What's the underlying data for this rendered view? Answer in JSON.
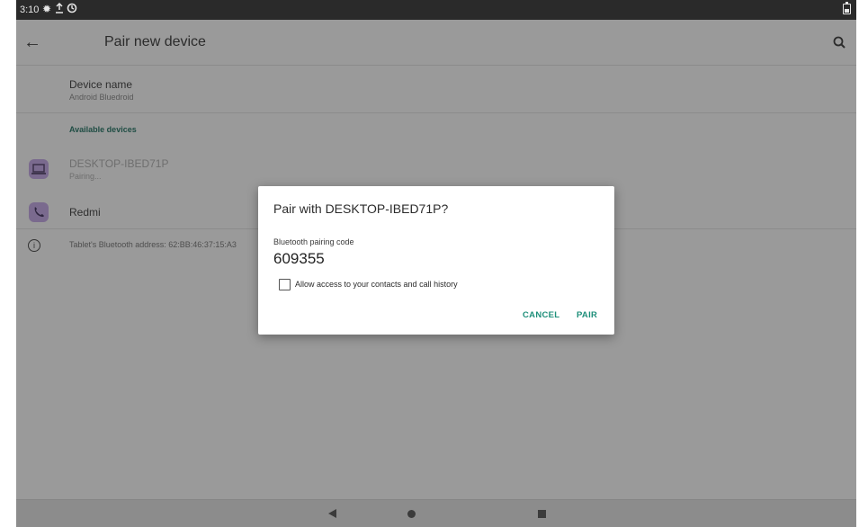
{
  "status_bar": {
    "time": "3:10",
    "icons": [
      "gear-icon",
      "upload-icon",
      "sync-icon",
      "battery-icon"
    ]
  },
  "app_bar": {
    "title": "Pair new device",
    "back_icon": "arrow-back-icon",
    "search_icon": "search-icon"
  },
  "device_name": {
    "label": "Device name",
    "value": "Android Bluedroid"
  },
  "available_header": "Available devices",
  "devices": [
    {
      "name": "DESKTOP-IBED71P",
      "status": "Pairing...",
      "icon": "laptop-icon"
    },
    {
      "name": "Redmi",
      "status": "",
      "icon": "phone-icon"
    }
  ],
  "info": {
    "text": "Tablet's Bluetooth address: 62:BB:46:37:15:A3",
    "icon": "info-icon"
  },
  "dialog": {
    "title": "Pair with DESKTOP-IBED71P?",
    "code_label": "Bluetooth pairing code",
    "code": "609355",
    "checkbox_label": "Allow access to your contacts and call history",
    "checkbox_checked": false,
    "cancel": "CANCEL",
    "pair": "PAIR"
  },
  "colors": {
    "accent": "#1e8f7a",
    "scrim": "#9a9a9a",
    "icon_bg": "#7a6a8e"
  }
}
